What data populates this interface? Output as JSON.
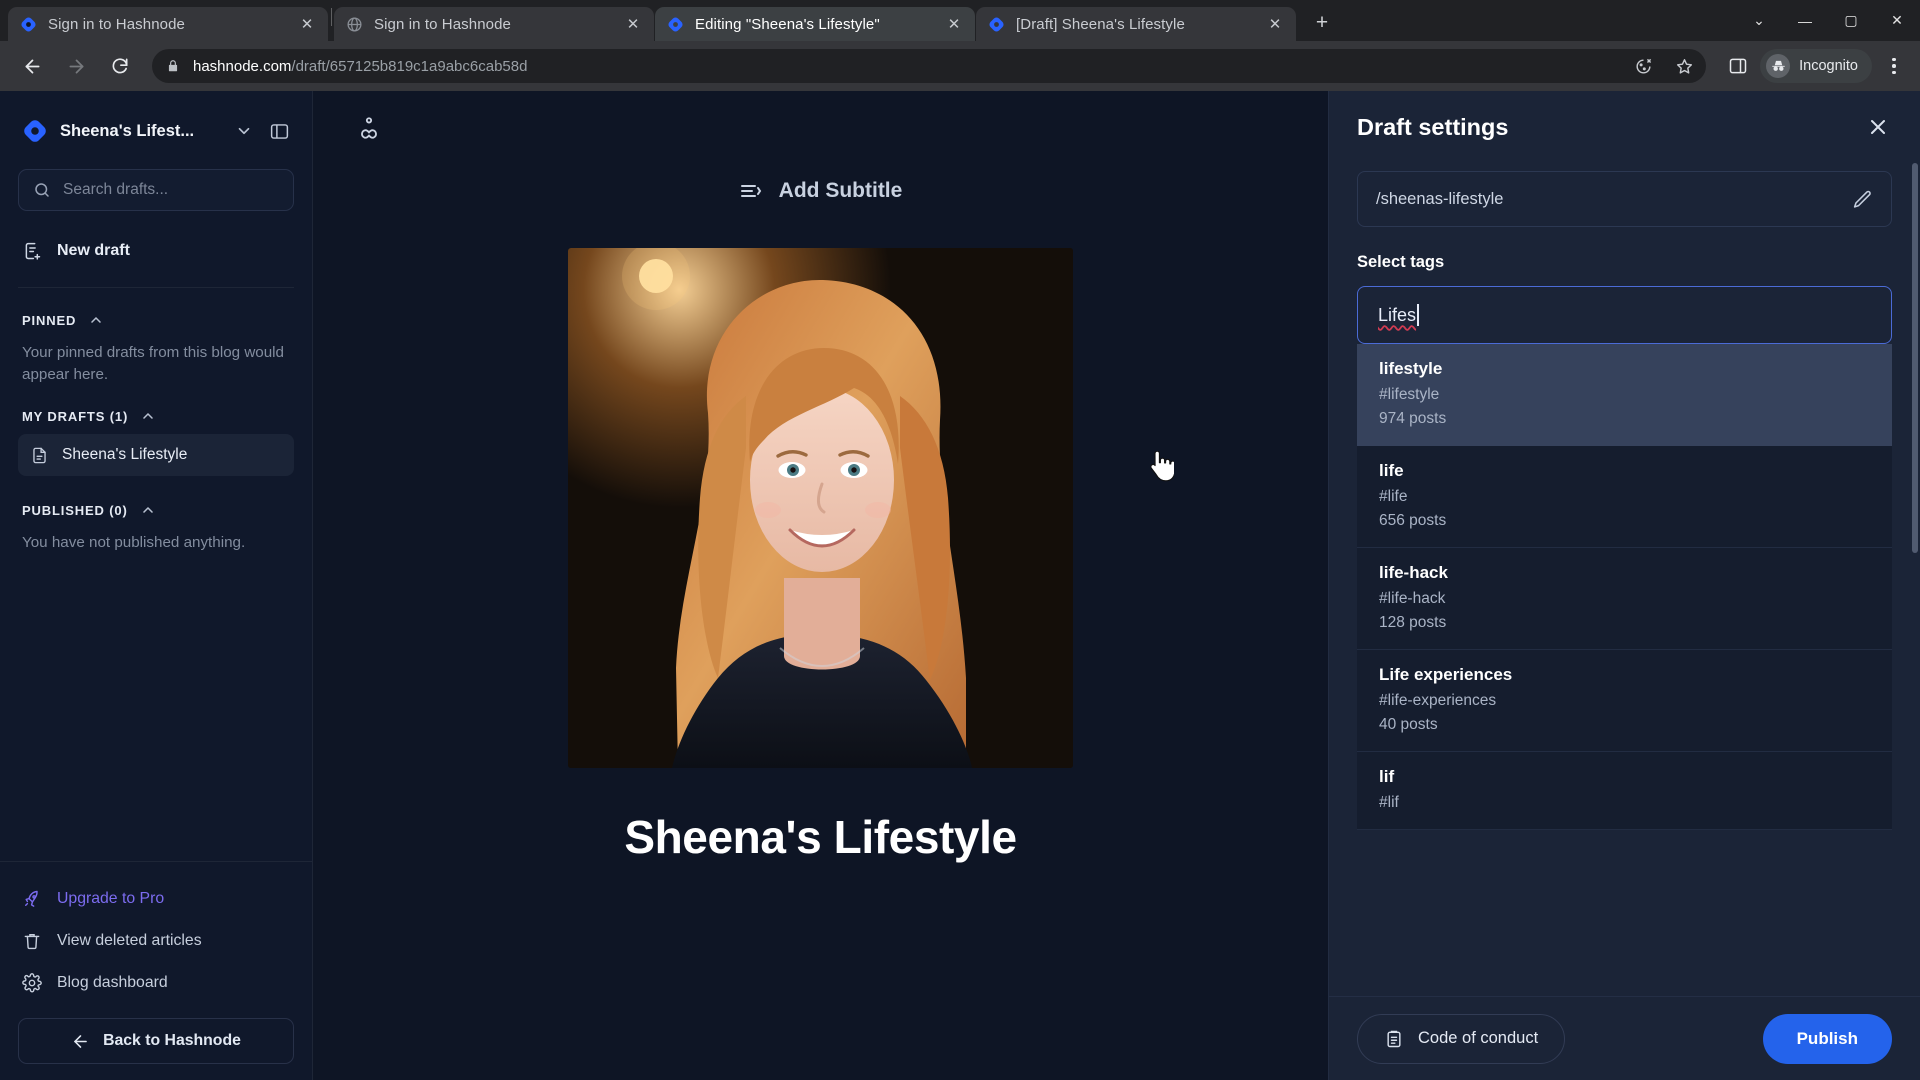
{
  "browser": {
    "tabs": [
      {
        "title": "Sign in to Hashnode",
        "favicon": "hashnode-logo",
        "active": false
      },
      {
        "title": "Sign in to Hashnode",
        "favicon": "globe",
        "active": false
      },
      {
        "title": "Editing \"Sheena's Lifestyle\"",
        "favicon": "hashnode-logo",
        "active": true
      },
      {
        "title": "[Draft] Sheena's Lifestyle",
        "favicon": "hashnode-logo",
        "active": false
      }
    ],
    "new_tab_label": "+",
    "window_controls": {
      "minimize": "—",
      "maximize": "▢",
      "close": "✕",
      "tab_search": "⌄"
    },
    "url_host": "hashnode.com",
    "url_path": "/draft/657125b819c1a9abc6cab58d",
    "profile_label": "Incognito",
    "icons": {
      "back": "back-arrow-icon",
      "forward": "forward-arrow-icon",
      "reload": "reload-icon",
      "lock": "lock-icon",
      "third_party": "third-party-cookie-icon",
      "bookmark": "star-icon",
      "side_panel": "side-panel-icon",
      "menu": "kebab-menu-icon"
    }
  },
  "sidebar": {
    "blog_name": "Sheena's Lifest...",
    "search_placeholder": "Search drafts...",
    "search_value": "",
    "new_draft_label": "New draft",
    "sections": [
      {
        "title": "PINNED",
        "note": "Your pinned drafts from this blog would appear here.",
        "items": []
      },
      {
        "title": "MY DRAFTS (1)",
        "note": "",
        "items": [
          {
            "label": "Sheena's Lifestyle",
            "selected": true
          }
        ]
      },
      {
        "title": "PUBLISHED (0)",
        "note": "You have not published anything.",
        "items": []
      }
    ],
    "links": [
      {
        "label": "Upgrade to Pro",
        "icon": "rocket-icon",
        "accent": "#7c6cf0"
      },
      {
        "label": "View deleted articles",
        "icon": "trash-icon",
        "accent": ""
      },
      {
        "label": "Blog dashboard",
        "icon": "gear-icon",
        "accent": ""
      }
    ],
    "back_label": "Back to Hashnode"
  },
  "editor": {
    "add_subtitle_label": "Add Subtitle",
    "post_title": "Sheena's Lifestyle",
    "top_icon": "user-settings-icon",
    "cover_alt": "Portrait photo of a smiling woman with long reddish-blonde hair wearing a dark top"
  },
  "panel": {
    "title": "Draft settings",
    "close_icon": "close-icon",
    "slug_value": "/sheenas-lifestyle",
    "slug_edit_icon": "pencil-icon",
    "tags_label": "Select tags",
    "tag_input_value": "Lifes",
    "tag_suggestions": [
      {
        "name": "lifestyle",
        "slug": "#lifestyle",
        "count": "974 posts",
        "highlighted": true
      },
      {
        "name": "life",
        "slug": "#life",
        "count": "656 posts",
        "highlighted": false
      },
      {
        "name": "life-hack",
        "slug": "#life-hack",
        "count": "128 posts",
        "highlighted": false
      },
      {
        "name": "Life experiences",
        "slug": "#life-experiences",
        "count": "40 posts",
        "highlighted": false
      },
      {
        "name": "lif",
        "slug": "#lif",
        "count": "",
        "highlighted": false
      }
    ],
    "code_of_conduct_label": "Code of conduct",
    "code_of_conduct_icon": "clipboard-icon",
    "publish_label": "Publish",
    "accent_color": "#2463eb"
  }
}
